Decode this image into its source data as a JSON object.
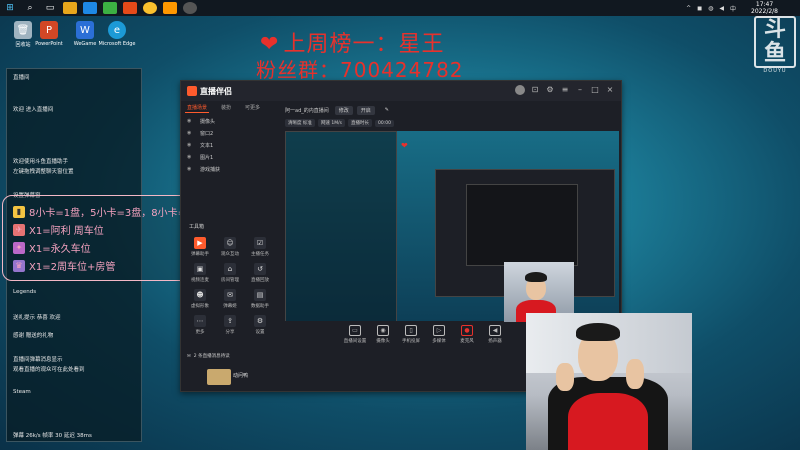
{
  "taskbar": {
    "time": "17:47",
    "date": "2022/2/8",
    "icons": [
      "windows-icon",
      "search-icon",
      "task-view-icon",
      "file-explorer-icon",
      "browser-icon",
      "wechat-icon",
      "game-icon",
      "chrome-icon",
      "app-icon",
      "obs-icon"
    ]
  },
  "watermark": {
    "big": "斗鱼",
    "small": "DOUYU"
  },
  "headline": {
    "line1": "上周榜一：星王",
    "line2": "粉丝群：700424782"
  },
  "desktop_icons": [
    {
      "label": "回收站"
    },
    {
      "label": "PowerPoint"
    },
    {
      "label": "WeGame"
    },
    {
      "label": "Microsoft Edge"
    }
  ],
  "left_panel": {
    "lines": [
      "直播间",
      "欢迎 进入直播间",
      "欢迎使用斗鱼直播助手",
      "左键拖拽调整聊天窗位置",
      "设置弹幕窗",
      "Legends",
      "送礼提示 恭喜 欢迎",
      "感谢 赠送的礼物",
      "直播间弹幕消息显示",
      "观看直播的观众可在此处看到",
      "Steam",
      "弹幕 26k/s 帧率 30  延迟 38ms"
    ]
  },
  "popup": {
    "line1": "8小卡=1盘，5小卡=3盘，8小卡=当晚车位",
    "line2": "X1=阿利 周车位",
    "line3": "X1=永久车位",
    "line4": "X1=2周车位+房管"
  },
  "app": {
    "logo": "直播伴侣",
    "tabs": [
      "直播场景",
      "装扮",
      "可更多"
    ],
    "scenes": [
      "摄像头",
      "窗口2",
      "文本1",
      "图片1",
      "游戏捕获"
    ],
    "tools_label": "工具箱",
    "tools": [
      {
        "label": "弹幕助手",
        "hot": true
      },
      {
        "label": "观众互动",
        "hot": false
      },
      {
        "label": "主播任务",
        "hot": false
      },
      {
        "label": "视频连麦",
        "hot": false
      },
      {
        "label": "房间管理",
        "hot": false
      },
      {
        "label": "直播回放",
        "hot": false
      },
      {
        "label": "虚拟形象",
        "hot": false
      },
      {
        "label": "弹幕姬",
        "hot": false
      },
      {
        "label": "数据助手",
        "hot": false
      },
      {
        "label": "更多",
        "hot": false
      },
      {
        "label": "分享",
        "hot": false
      },
      {
        "label": "设置",
        "hot": false
      }
    ],
    "preview_top": {
      "title": "阿一ad_的内直播间",
      "edit": "修改",
      "more": "开启"
    },
    "preview_bar2": [
      "清晰度 标准",
      "网速 1M/s",
      "直播时长",
      "00:00"
    ],
    "bottom_bar": [
      {
        "label": "直播间设置"
      },
      {
        "label": "摄像头"
      },
      {
        "label": "手机投屏"
      },
      {
        "label": "多媒体"
      },
      {
        "label": "麦克风"
      },
      {
        "label": "扬声器"
      }
    ],
    "chat_notice": "2 条直播消息待读",
    "chat_user": "动问鸭"
  }
}
